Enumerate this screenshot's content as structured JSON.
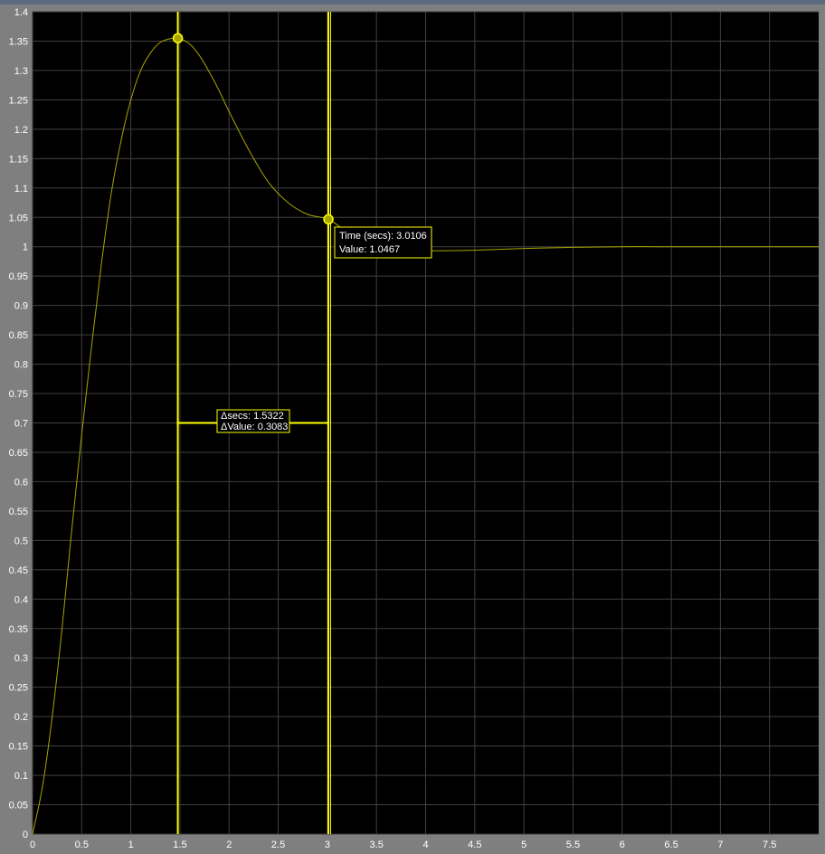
{
  "colors": {
    "background": "#000000",
    "frame": "#7f7f7f",
    "grid": "#404040",
    "trace": "#a8a500",
    "cursor": "#ffff00",
    "label_text": "#ffffff"
  },
  "chart_data": {
    "type": "line",
    "title": "",
    "xlabel": "",
    "ylabel": "",
    "xlim": [
      0,
      8
    ],
    "ylim": [
      0,
      1.4
    ],
    "grid": true,
    "x_ticks": [
      "0",
      "0.5",
      "1",
      "1.5",
      "2",
      "2.5",
      "3",
      "3.5",
      "4",
      "4.5",
      "5",
      "5.5",
      "6",
      "6.5",
      "7",
      "7.5"
    ],
    "y_ticks": [
      "0",
      "0.05",
      "0.1",
      "0.15",
      "0.2",
      "0.25",
      "0.3",
      "0.35",
      "0.4",
      "0.45",
      "0.5",
      "0.55",
      "0.6",
      "0.65",
      "0.7",
      "0.75",
      "0.8",
      "0.85",
      "0.9",
      "0.95",
      "1",
      "1.05",
      "1.1",
      "1.15",
      "1.2",
      "1.25",
      "1.3",
      "1.35",
      "1.4"
    ],
    "series": [
      {
        "x": [
          0,
          0.1,
          0.2,
          0.3,
          0.4,
          0.5,
          0.6,
          0.7,
          0.8,
          0.9,
          1.0,
          1.1,
          1.2,
          1.3,
          1.4,
          1.48,
          1.6,
          1.7,
          1.8,
          1.9,
          2.0,
          2.2,
          2.4,
          2.6,
          2.8,
          3.0106,
          3.2,
          3.4,
          3.6,
          3.8,
          4.0,
          4.5,
          5.0,
          5.5,
          6.0,
          6.5,
          7.0,
          7.5,
          8.0
        ],
        "y": [
          0,
          0.08,
          0.2,
          0.35,
          0.52,
          0.68,
          0.83,
          0.97,
          1.09,
          1.18,
          1.25,
          1.3,
          1.33,
          1.348,
          1.354,
          1.3552,
          1.345,
          1.325,
          1.297,
          1.265,
          1.23,
          1.165,
          1.11,
          1.075,
          1.055,
          1.0467,
          1.025,
          1.008,
          0.998,
          0.994,
          0.993,
          0.994,
          0.997,
          0.999,
          1.0,
          1.0,
          1.0,
          1.0,
          1.0
        ]
      }
    ],
    "cursors": [
      {
        "time": 1.4784,
        "value": 1.355
      },
      {
        "time": 3.0106,
        "value": 1.0467
      }
    ],
    "measurement_level": 0.7,
    "annotations": {
      "cursor_readout": {
        "line1": "Time (secs): 3.0106",
        "line2": "Value: 1.0467"
      },
      "delta_readout": {
        "line1": "Δsecs: 1.5322",
        "line2": "ΔValue: 0.3083"
      }
    }
  }
}
